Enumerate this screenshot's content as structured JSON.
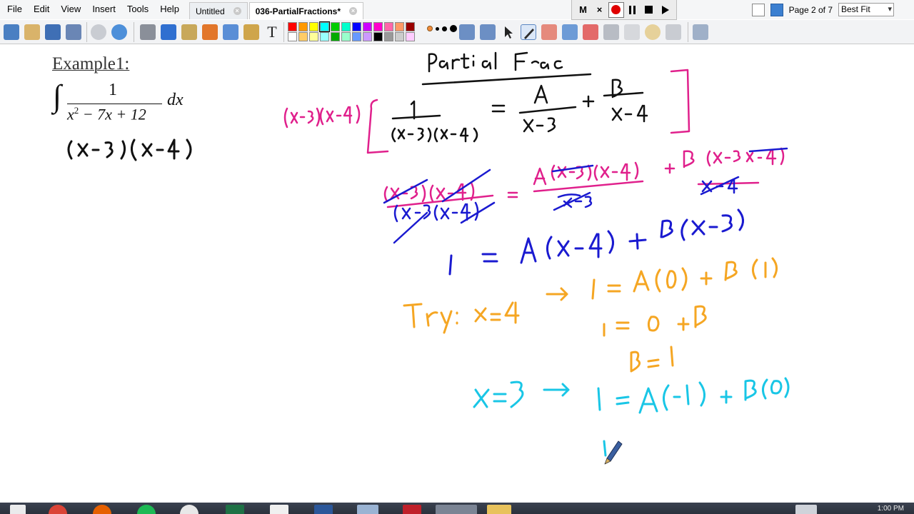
{
  "menu": [
    "File",
    "Edit",
    "View",
    "Insert",
    "Tools",
    "Help"
  ],
  "tabs": [
    {
      "label": "Untitled",
      "active": false
    },
    {
      "label": "036-PartialFractions*",
      "active": true
    }
  ],
  "recorder": {
    "m_label": "M",
    "x_label": "×"
  },
  "page_indicator": "Page 2 of 7",
  "zoom": "Best Fit",
  "palette": [
    "#ff0000",
    "#ff9900",
    "#ffff00",
    "#00ffff",
    "#00cc00",
    "#00ffcc",
    "#0000ff",
    "#cc00ff",
    "#ff00cc",
    "#ff66aa",
    "#ff9966",
    "#990000",
    "#ffffff",
    "#ffcc66",
    "#ffff99",
    "#99ffff",
    "#00aa00",
    "#99ffcc",
    "#6699ff",
    "#cc99ff",
    "#000000",
    "#999999",
    "#cccccc",
    "#ffccff"
  ],
  "canvas": {
    "example_title": "Example1:",
    "integral": {
      "numerator": "1",
      "denominator_pre": "x",
      "denominator_exp": "2",
      "denominator_post": " − 7x + 12",
      "differential": "dx"
    },
    "ink_colors": {
      "black": "#111111",
      "magenta": "#e0208c",
      "blue": "#1a1ad0",
      "orange": "#f5a623",
      "cyan": "#19c6e6"
    }
  },
  "taskbar": {
    "clock": "1:00 PM"
  }
}
